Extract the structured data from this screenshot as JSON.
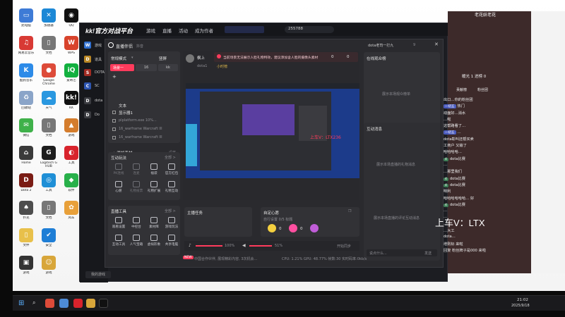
{
  "desktop": {
    "icons": [
      {
        "label": "此电脑",
        "color": "#3e7bd6",
        "glyph": "▭"
      },
      {
        "label": "网易云音乐",
        "color": "#d83a34",
        "glyph": "♫"
      },
      {
        "label": "酷狗音乐",
        "color": "#2d8be8",
        "glyph": "K"
      },
      {
        "label": "回收站",
        "color": "#8aa4c8",
        "glyph": "♻"
      },
      {
        "label": "微信",
        "color": "#3fb14a",
        "glyph": "✉"
      },
      {
        "label": "Home",
        "color": "#3a3a3a",
        "glyph": "⌂"
      },
      {
        "label": "Dota 2",
        "color": "#7a1c14",
        "glyph": "D"
      },
      {
        "label": "扑克",
        "color": "#4d4d4d",
        "glyph": "♠"
      },
      {
        "label": "文件",
        "color": "#e8c04a",
        "glyph": "▯"
      },
      {
        "label": "游戏",
        "color": "#333",
        "glyph": "▣"
      },
      {
        "label": "加速器",
        "color": "#1c88d6",
        "glyph": "✕"
      },
      {
        "label": "文档",
        "color": "#777",
        "glyph": "▯"
      },
      {
        "label": "Google Chrome",
        "color": "#dd4b39",
        "glyph": "●"
      },
      {
        "label": "天气",
        "color": "#2a98e0",
        "glyph": "☁"
      },
      {
        "label": "文档",
        "color": "#777",
        "glyph": "▯"
      },
      {
        "label": "Logitech G HUB",
        "color": "#1d1d1d",
        "glyph": "G"
      },
      {
        "label": "工具",
        "color": "#1f8fd6",
        "glyph": "◎"
      },
      {
        "label": "文档",
        "color": "#777",
        "glyph": "▯"
      },
      {
        "label": "安全",
        "color": "#1e7ed6",
        "glyph": "✔"
      },
      {
        "label": "游戏",
        "color": "#d8a63a",
        "glyph": "☺"
      },
      {
        "label": "QQ",
        "color": "#111",
        "glyph": "◉"
      },
      {
        "label": "WPS",
        "color": "#d8432c",
        "glyph": "W"
      },
      {
        "label": "爱奇艺",
        "color": "#12b03f",
        "glyph": "iQ"
      },
      {
        "label": "KK",
        "color": "#111",
        "glyph": "kk!"
      },
      {
        "label": "游戏",
        "color": "#d47c2c",
        "glyph": "▲"
      },
      {
        "label": "工具",
        "color": "#d8232c",
        "glyph": "◐"
      },
      {
        "label": "软件",
        "color": "#28b04a",
        "glyph": "◆"
      },
      {
        "label": "风车",
        "color": "#e8a03a",
        "glyph": "✿"
      }
    ]
  },
  "kk": {
    "logo": "kk!官方对战平台",
    "nav": [
      "游戏",
      "直播",
      "活动",
      "成为作者"
    ],
    "search_value": "255788",
    "side_letters": [
      "W",
      "D",
      "S",
      "C",
      "D",
      "D"
    ],
    "side_labels": [
      "游戏",
      "道具",
      "DOTA",
      "SC",
      "dota",
      "Do"
    ],
    "bottom_button": "我的游戏"
  },
  "live": {
    "app_title": "直播伴侣",
    "app_sub": "抖音",
    "mode_label": "常规模式",
    "mode_chevron": "▾",
    "orientation": "竖屏",
    "scene": "场景一",
    "res": "16",
    "kbps": "kk",
    "add": "+",
    "sources_title": "文本",
    "sources": [
      {
        "name": "显示器1",
        "state": "on"
      },
      {
        "name": "plplatform.exe 10%...",
        "state": "off"
      },
      {
        "name": "16_warframe Warcraft III",
        "state": "off"
      },
      {
        "name": "16_warframe Warcraft III",
        "state": "off"
      }
    ],
    "add_source": "+ 添加素材",
    "add_source_right": "设定",
    "interact_title": "互动玩法",
    "interact_more": "全部 >",
    "interact": [
      {
        "t": "PK连线",
        "on": false
      },
      {
        "t": "连麦",
        "on": false
      },
      {
        "t": "福袋",
        "on": true
      },
      {
        "t": "官方红包",
        "on": true
      },
      {
        "t": "心愿",
        "on": true
      },
      {
        "t": "礼物投票",
        "on": false
      },
      {
        "t": "礼物扩展",
        "on": true
      },
      {
        "t": "礼物互动",
        "on": true
      }
    ],
    "tools_title": "直播工具",
    "tools_more": "全部 >",
    "tools": [
      {
        "t": "观看设置"
      },
      {
        "t": "中控台"
      },
      {
        "t": "素材库"
      },
      {
        "t": "游戏玩法"
      },
      {
        "t": "互动工具"
      },
      {
        "t": "人气宝箱"
      },
      {
        "t": "虚拟形象"
      },
      {
        "t": "共享电脑"
      }
    ],
    "warning": "当前场景无法展示人脸礼物特效，建议添加含人脸的摄像头素材",
    "streamer_name": "枫上",
    "streamer_tag": "dota1",
    "streamer_sub": "小时榜",
    "stat_like": "0",
    "stat_gift": "0",
    "watermark": "上车V：LTX236",
    "main_task": "主播任务",
    "wish_title": "自定心愿",
    "wish_sub": "自行设置 0/5 标题",
    "wish_count": "0",
    "volume1": "100%",
    "volume2": "51%",
    "sync": "开始同步",
    "status": "CPU: 1.21%   GPU: 48.77%   帧数:30   实时码率:0kb/s",
    "status_left": "NEW",
    "status_left_text": "中国合作伙伴, 展现精彩内容, 3次机会...",
    "online_title": "在线观众榜",
    "online_empty": "展示本场观众榜单",
    "interact_msg_title": "互动消息",
    "interact_msg_empty": "展示本场直播的礼物消息",
    "interact_msg_empty2": "展示本场直播的评论互动消息",
    "chat_placeholder": "说点什么...",
    "send": "发送",
    "header_user": "dota老司一打九",
    "header_num": "9"
  },
  "chat": {
    "top_name": "老花妖老花",
    "tab_rank": "贡献榜",
    "tab_fans": "粉丝团",
    "tab_hot": "热门",
    "tab_b": "人气",
    "rank_line": "暖光 1     进榜 0",
    "lines": [
      {
        "b": "",
        "t": "出口…你的粉丝团"
      },
      {
        "b": "一初五",
        "t": "热门"
      },
      {
        "b": "",
        "t": "动面好…消水"
      },
      {
        "b": "",
        "t": "…啦"
      },
      {
        "b": "",
        "t": "这帮路看了…"
      },
      {
        "b": "一初五",
        "t": "…"
      },
      {
        "b": "",
        "t": "dota彰叫还帮买卖"
      },
      {
        "b": "",
        "t": "工商户  又输了"
      },
      {
        "b": "",
        "t": "哈哈哈哈…"
      },
      {
        "b": "4",
        "t": "dota比赛"
      },
      {
        "b": "",
        "t": "…"
      },
      {
        "b": "",
        "t": "…那里我们"
      },
      {
        "b": "4",
        "t": "dota比赛"
      },
      {
        "b": "4",
        "t": "dota比赛"
      },
      {
        "b": "",
        "t": "明利"
      },
      {
        "b": "",
        "t": "哈哈哈哈哈哈…  好"
      },
      {
        "b": "4",
        "t": "dota比赛"
      },
      {
        "b": "",
        "t": "…"
      },
      {
        "b": "",
        "t": "…"
      },
      {
        "b": "",
        "t": "…"
      },
      {
        "b": "",
        "t": "…大工"
      },
      {
        "b": "",
        "t": "dota…"
      },
      {
        "b": "",
        "t": "增则标  来啦"
      },
      {
        "b": "",
        "t": "回复  粉丝牌子是000  来啦"
      }
    ],
    "watermark": "上车V：LTX",
    "side_texts": [
      "0.0",
      "…",
      "…"
    ]
  },
  "taskbar": {
    "time": "21:02",
    "date": "2025/9/18"
  },
  "colors": {
    "accent": "#ff3b5c",
    "kk_red": "#e8192c",
    "link": "#4f7cff"
  }
}
